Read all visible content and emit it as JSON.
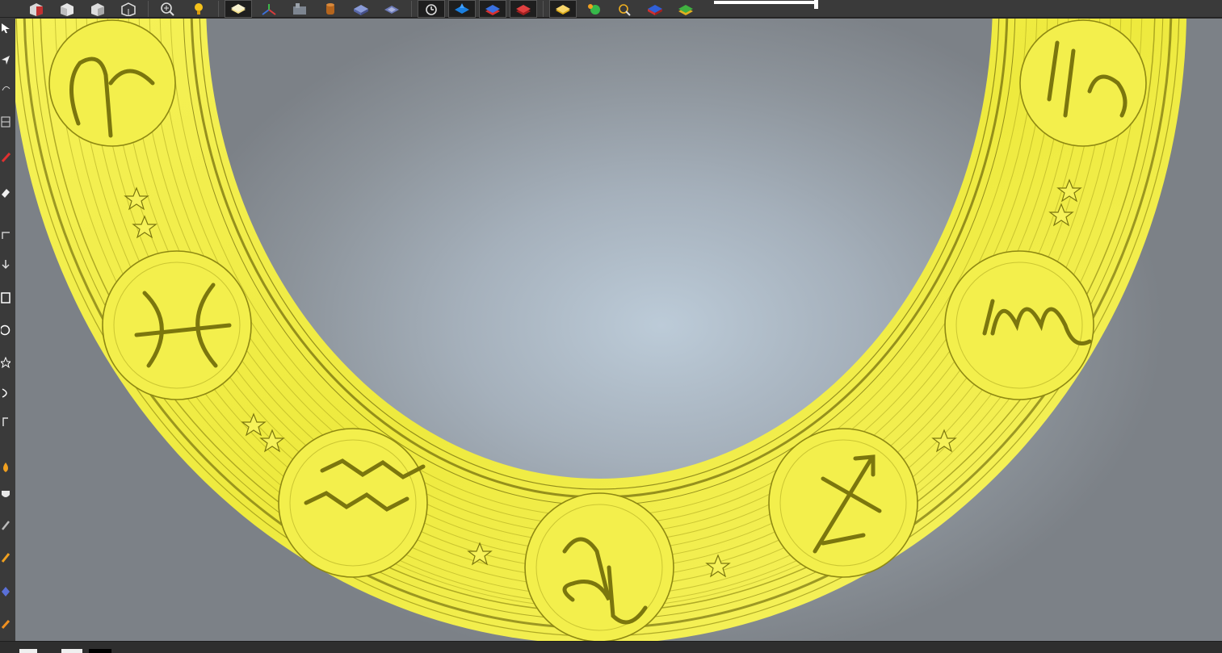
{
  "toolbar": {
    "icons": [
      "view-cube-front-icon",
      "view-cube-back-icon",
      "view-cube-side-icon",
      "view-cube-iso-icon",
      "zoom-icon",
      "light-icon",
      "layer-icon",
      "axis-icon",
      "component-icon",
      "cylinder-icon",
      "block-icon",
      "plane-icon",
      "history-icon",
      "blue-relief-icon",
      "layers-icon",
      "red-layers-icon",
      "yellow-layer-icon",
      "green-sphere-icon",
      "magnify-icon",
      "blue-red-cube-icon",
      "green-layers-icon"
    ],
    "zoom_level": 1.0
  },
  "left_tools": {
    "icons": [
      "select-arrow-icon",
      "node-edit-icon",
      "transform-icon",
      "frame-icon",
      "pen-icon",
      "eraser-icon",
      "corner-icon",
      "flip-icon",
      "rectangle-icon",
      "circle-icon",
      "star-icon",
      "arc-icon",
      "bracket-icon",
      "drop-icon",
      "shield-icon",
      "pencil-icon",
      "orange-pencil-icon",
      "blue-diamond-icon",
      "orange-brush-icon"
    ]
  },
  "viewport": {
    "model": "zodiac-ring-relief",
    "ring_color": "#f2ee4a",
    "background_center": "#bccbd8",
    "background_edge": "#7c8187",
    "symbols": [
      "aries-glyph",
      "pisces-glyph",
      "aquarius-glyph",
      "capricorn-glyph",
      "sagittarius-glyph",
      "scorpio-glyph",
      "libra-glyph"
    ]
  },
  "statusbar": {
    "colors": [
      "#ffffff",
      "#f0f0f0",
      "#000000"
    ]
  }
}
